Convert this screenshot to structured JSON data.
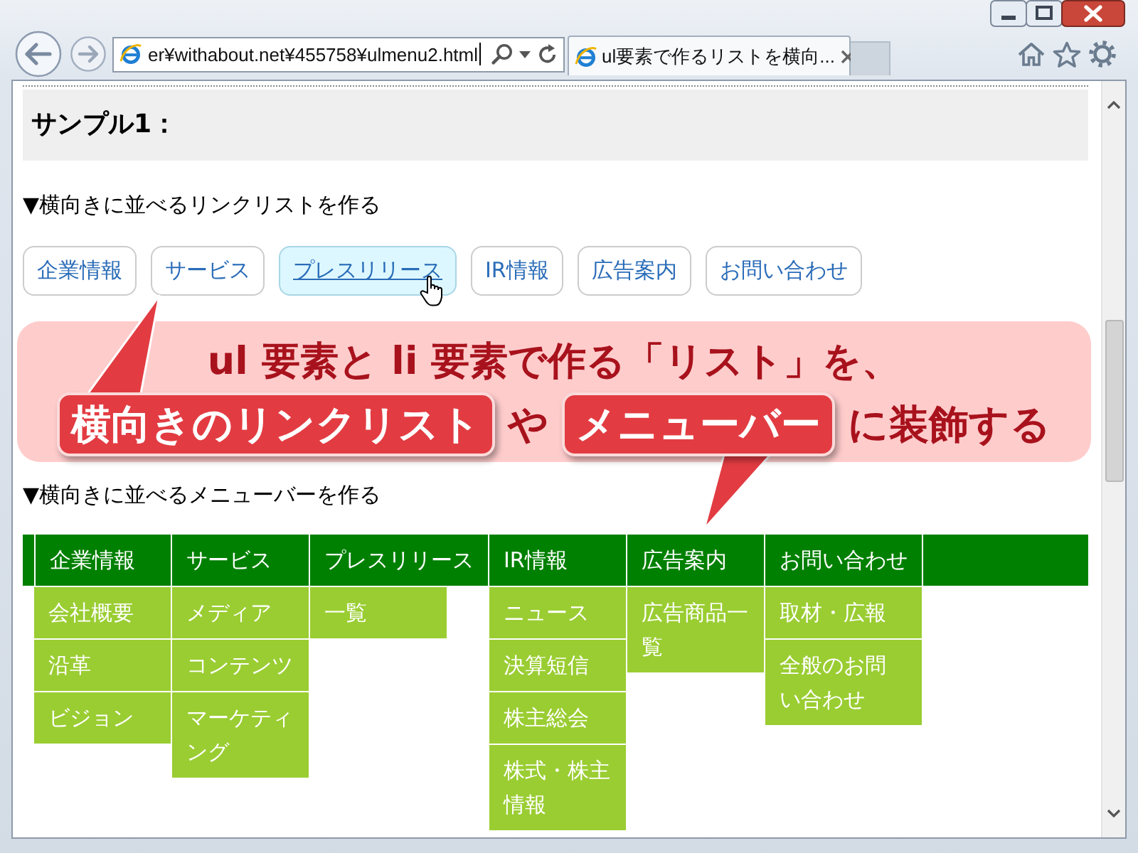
{
  "browser": {
    "address": "er¥withabout.net¥455758¥ulmenu2.html",
    "tabs": [
      {
        "title": "ul要素で作るリストを横向...",
        "selected": true
      }
    ]
  },
  "page": {
    "heading": "サンプル1：",
    "link_list": {
      "caption": "▼横向きに並べるリンクリストを作る",
      "links": [
        {
          "label": "企業情報",
          "hovered": false
        },
        {
          "label": "サービス",
          "hovered": false
        },
        {
          "label": "プレスリリース",
          "hovered": true
        },
        {
          "label": "IR情報",
          "hovered": false
        },
        {
          "label": "広告案内",
          "hovered": false
        },
        {
          "label": "お問い合わせ",
          "hovered": false
        }
      ]
    },
    "callout": {
      "line_1": "ul 要素と li 要素で作る「リスト」を、",
      "line_2": [
        {
          "kind": "highlight",
          "text": "横向きのリンクリスト",
          "pointer_above": true
        },
        {
          "kind": "plain",
          "text": "や"
        },
        {
          "kind": "highlight",
          "text": "メニューバー",
          "pointer_above": false
        },
        {
          "kind": "plain",
          "text": "に装飾する"
        }
      ]
    },
    "menu_bar": {
      "caption": "▼横向きに並べるメニューバーを作る",
      "menus": [
        {
          "label": "企業情報",
          "items": [
            "会社概要",
            "沿革",
            "ビジョン"
          ]
        },
        {
          "label": "サービス",
          "items": [
            "メディア",
            "コンテンツ",
            "マーケティング"
          ]
        },
        {
          "label": "プレスリリース",
          "items": [
            "一覧"
          ]
        },
        {
          "label": "IR情報",
          "items": [
            "ニュース",
            "決算短信",
            "株主総会",
            "株式・株主情報"
          ]
        },
        {
          "label": "広告案内",
          "items": [
            "広告商品一覧"
          ]
        },
        {
          "label": "お問い合わせ",
          "items": [
            "取材・広報",
            "全般のお問い合わせ"
          ]
        }
      ]
    }
  }
}
